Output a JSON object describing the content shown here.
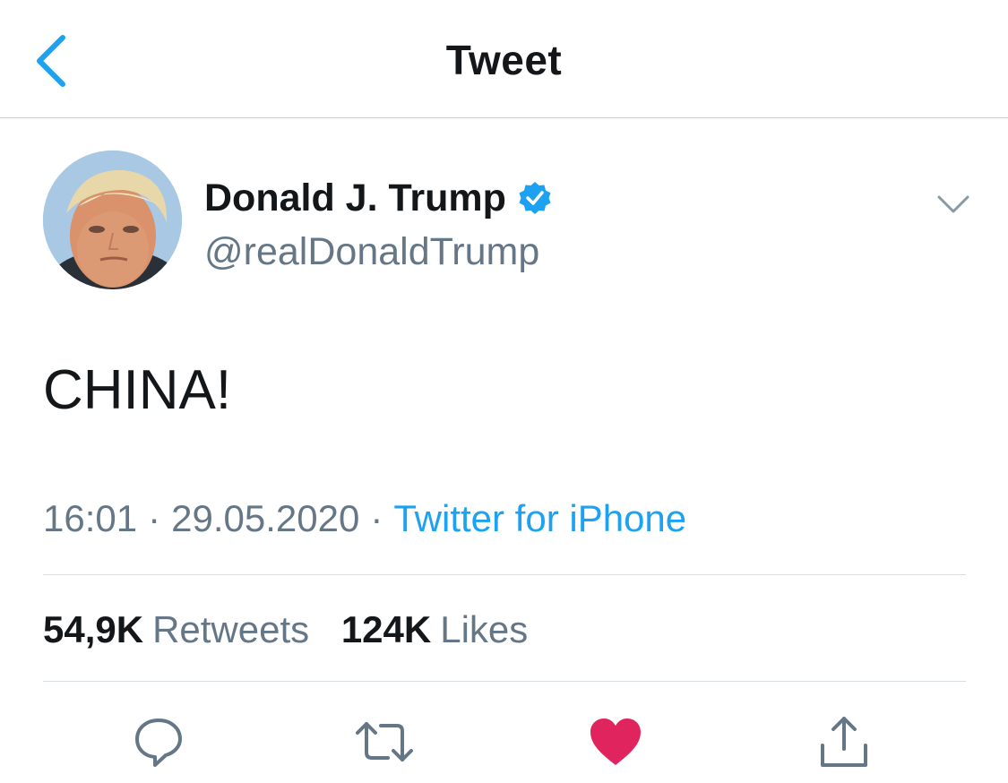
{
  "header": {
    "title": "Tweet",
    "back_icon": "chevron-left-icon"
  },
  "author": {
    "display_name": "Donald J. Trump",
    "handle": "@realDonaldTrump",
    "verified": true,
    "avatar": "avatar-photo"
  },
  "tweet": {
    "text": "CHINA!"
  },
  "meta": {
    "time": "16:01",
    "separator": "·",
    "date": "29.05.2020",
    "source": "Twitter for iPhone"
  },
  "stats": {
    "retweets_count": "54,9K",
    "retweets_label": "Retweets",
    "likes_count": "124K",
    "likes_label": "Likes"
  },
  "actions": {
    "reply_icon": "reply-icon",
    "retweet_icon": "retweet-icon",
    "like_icon": "heart-icon",
    "share_icon": "share-icon",
    "liked": true
  },
  "colors": {
    "accent": "#1da1f2",
    "secondary_text": "#657786",
    "like": "#e0245e",
    "text": "#14171a"
  }
}
